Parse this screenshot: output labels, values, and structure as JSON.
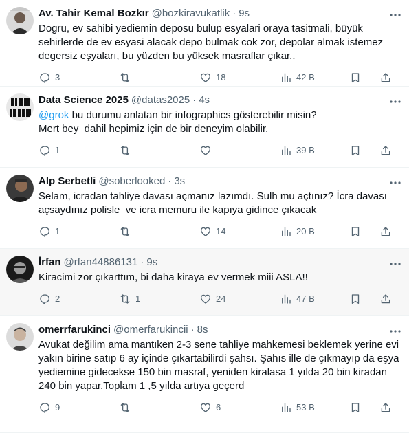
{
  "tweets": [
    {
      "name": "Av. Tahir Kemal Bozkır",
      "handle": "@bozkiravukatlik",
      "time": "9s",
      "text": "Dogru, ev sahibi yediemin deposu bulup esyalari oraya tasitmali, büyük sehirlerde de ev esyasi alacak depo bulmak cok zor, depolar almak istemez degersiz eşyaları, bu yüzden bu yüksek masraflar çıkar..",
      "replies": "3",
      "retweets": "",
      "likes": "18",
      "views": "42 B"
    },
    {
      "name": "Data Science 2025",
      "handle": "@datas2025",
      "time": "4s",
      "mention": "@grok",
      "text": " bu durumu anlatan bir infographics gösterebilir misin?\nMert bey  dahil hepimiz için de bir deneyim olabilir.",
      "replies": "1",
      "retweets": "",
      "likes": "",
      "views": "39 B"
    },
    {
      "name": "Alp Serbetli",
      "handle": "@soberlooked",
      "time": "3s",
      "text": "Selam, icradan tahliye davası açmanız lazımdı. Sulh mu açtınız? İcra davası açsaydınız polisle  ve icra memuru ile kapıya gidince çıkacak",
      "replies": "1",
      "retweets": "",
      "likes": "14",
      "views": "20 B"
    },
    {
      "name": "İrfan",
      "handle": "@rfan44886131",
      "time": "9s",
      "text": "Kiracimi zor çıkarttım, bi daha kiraya ev vermek miii ASLA!!",
      "replies": "2",
      "retweets": "1",
      "likes": "24",
      "views": "47 B"
    },
    {
      "name": "omerrfarukinci",
      "handle": "@omerfarukincii",
      "time": "8s",
      "text": "Avukat değilim ama mantıken 2-3 sene tahliye mahkemesi beklemek yerine evi yakın birine satıp 6 ay içinde çıkartabilirdi şahsı. Şahıs ille de çıkmayıp da eşya yediemine gidecekse 150 bin masraf, yeniden kiralasa 1 yılda 20 bin kiradan 240 bin yapar.Toplam 1 ,5 yılda artıya geçerd",
      "replies": "9",
      "retweets": "",
      "likes": "6",
      "views": "53 B"
    }
  ],
  "icons": {
    "reply": "reply-icon",
    "retweet": "retweet-icon",
    "like": "heart-icon",
    "views": "views-icon",
    "bookmark": "bookmark-icon",
    "share": "share-icon",
    "more": "more-icon"
  },
  "colors": {
    "text": "#0f1419",
    "secondary": "#536471",
    "link": "#1d9bf0",
    "border": "#eff3f4",
    "highlight": "#f7f7f7"
  }
}
